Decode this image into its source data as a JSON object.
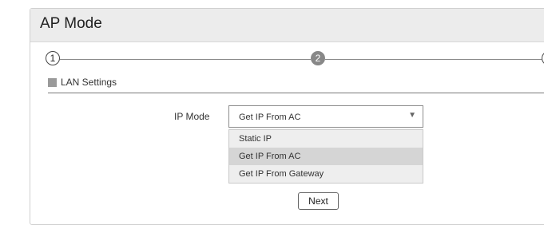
{
  "panel": {
    "title": "AP Mode"
  },
  "stepper": {
    "steps": [
      {
        "label": "1",
        "state": "completed"
      },
      {
        "label": "2",
        "state": "current"
      },
      {
        "label": "",
        "state": "upcoming"
      }
    ]
  },
  "section": {
    "title": "LAN Settings"
  },
  "ip_mode": {
    "label": "IP Mode",
    "selected": "Get IP From AC",
    "options": [
      "Static IP",
      "Get IP From AC",
      "Get IP From Gateway"
    ],
    "highlighted_index": 1
  },
  "actions": {
    "next_label": "Next"
  },
  "colors": {
    "header_bg": "#ececec",
    "current_step": "#888888",
    "dropdown_bg": "#eeeeee",
    "option_highlight": "#d5d5d5"
  },
  "icons": {
    "dropdown_arrow": "caret-down-icon",
    "section_marker": "square-icon"
  }
}
